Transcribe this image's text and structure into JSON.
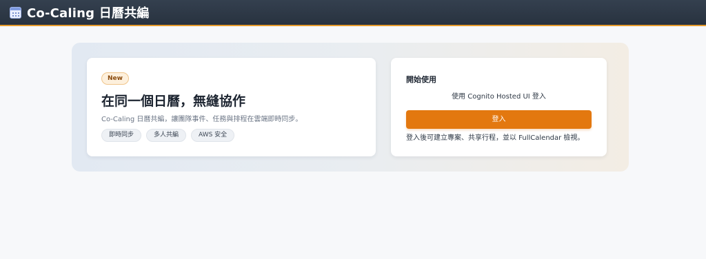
{
  "app": {
    "icon": "calendar-icon",
    "title": "Co-Caling 日曆共編",
    "accent_color": "#e3780f"
  },
  "hero": {
    "badge": "New",
    "heading": "在同一個日曆，無縫協作",
    "description": "Co-Caling 日曆共編，讓團隊事件、任務與排程在雲端即時同步。",
    "tags": [
      "即時同步",
      "多人共編",
      "AWS 安全"
    ]
  },
  "start": {
    "title": "開始使用",
    "subtitle": "使用 Cognito Hosted UI 登入",
    "login_label": "登入",
    "note": "登入後可建立專案、共享行程，並以 FullCalendar 檢視。"
  }
}
